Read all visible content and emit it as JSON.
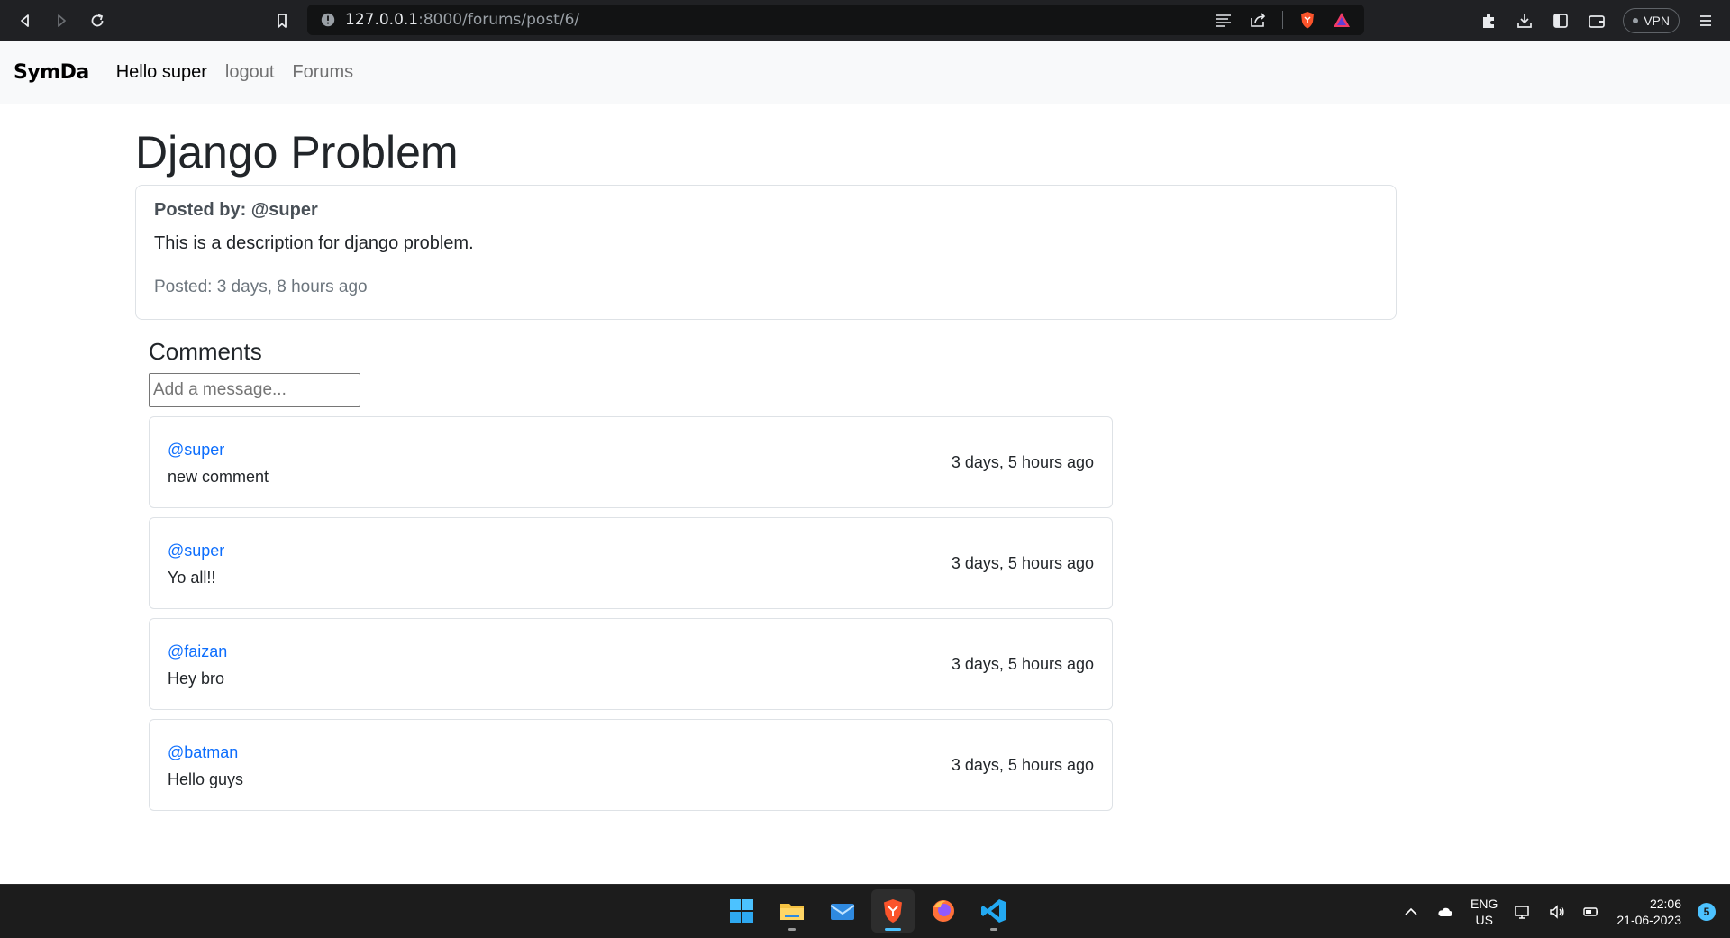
{
  "browser": {
    "url_host": "127.0.0.1",
    "url_rest": ":8000/forums/post/6/",
    "vpn_label": "VPN"
  },
  "navbar": {
    "brand": "SymDa",
    "greeting": "Hello super",
    "logout": "logout",
    "forums": "Forums"
  },
  "post": {
    "title": "Django Problem",
    "posted_by": "Posted by: @super",
    "description": "This is a description for django problem.",
    "posted_time": "Posted: 3 days, 8 hours ago"
  },
  "comments": {
    "heading": "Comments",
    "input_placeholder": "Add a message...",
    "items": [
      {
        "user": "@super",
        "text": "new comment",
        "time": "3 days, 5 hours ago"
      },
      {
        "user": "@super",
        "text": "Yo all!!",
        "time": "3 days, 5 hours ago"
      },
      {
        "user": "@faizan",
        "text": "Hey bro",
        "time": "3 days, 5 hours ago"
      },
      {
        "user": "@batman",
        "text": "Hello guys",
        "time": "3 days, 5 hours ago"
      }
    ]
  },
  "taskbar": {
    "apps": [
      "windows-start",
      "file-explorer",
      "mail",
      "brave-browser",
      "firefox",
      "vs-code"
    ],
    "lang_line1": "ENG",
    "lang_line2": "US",
    "time": "22:06",
    "date": "21-06-2023",
    "notification_count": "5"
  },
  "colors": {
    "link": "#0d6efd",
    "navbar_bg": "#f8f9fa",
    "chrome_bg": "#202124",
    "taskbar_bg": "#1c1c1c"
  }
}
